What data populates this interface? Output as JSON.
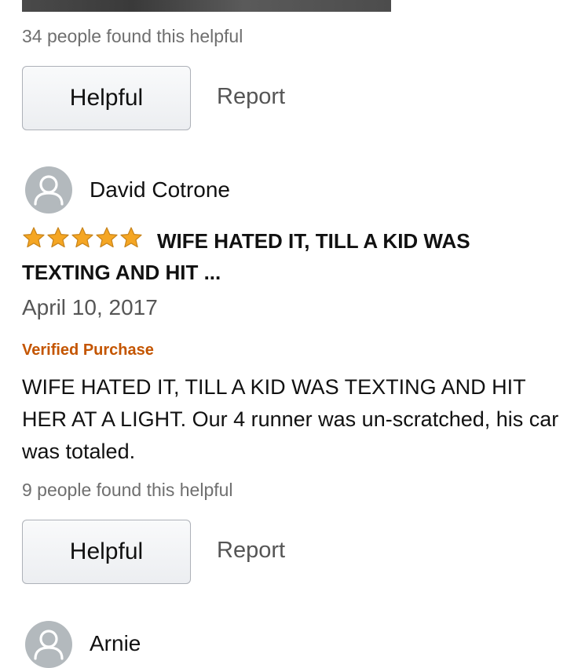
{
  "review_1": {
    "helpful_count": "34 people found this helpful",
    "helpful_label": "Helpful",
    "report_label": "Report"
  },
  "review_2": {
    "reviewer_name": "David Cotrone",
    "rating": 5,
    "rating_max": 5,
    "title": "WIFE HATED IT, TILL A KID WAS TEXTING AND HIT ...",
    "date": "April 10, 2017",
    "verified": "Verified Purchase",
    "body": "WIFE HATED IT, TILL A KID WAS TEXTING AND HIT HER AT A LIGHT. Our 4 runner was un-scratched, his car was totaled.",
    "helpful_count": "9 people found this helpful",
    "helpful_label": "Helpful",
    "report_label": "Report"
  },
  "review_3": {
    "reviewer_name": "Arnie"
  },
  "colors": {
    "star": "#f5a623",
    "verified": "#c45500",
    "avatar_bg": "#b3b9bd",
    "muted_text": "#6f6f6f"
  },
  "icons": {
    "avatar": "default-user-avatar-icon",
    "star": "star-icon"
  }
}
